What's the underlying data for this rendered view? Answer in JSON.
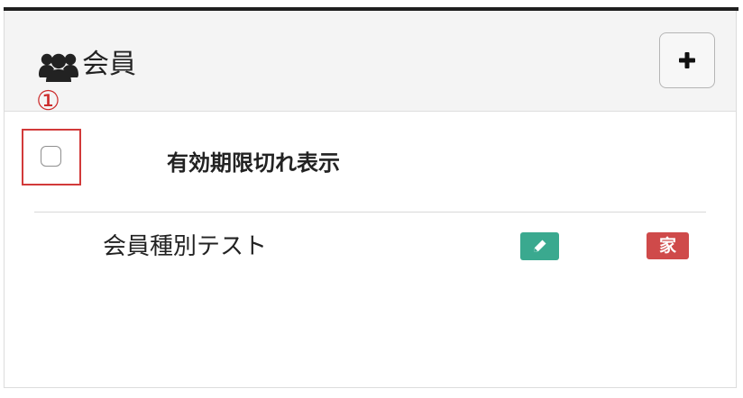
{
  "panel": {
    "title": "会員",
    "title_icon": "users-icon",
    "add_button_icon": "plus-icon",
    "add_button_label": "+"
  },
  "annotation": {
    "marker": "①",
    "color": "#d23a3a"
  },
  "filter": {
    "checkbox_checked": false,
    "label": "有効期限切れ表示"
  },
  "members": [
    {
      "name": "会員種別テスト",
      "edit_icon": "pencil-icon",
      "badge": "家",
      "edit_color": "#3aa98f",
      "badge_color": "#cf4a4a"
    }
  ],
  "colors": {
    "header_bg": "#f4f4f4",
    "top_border": "#1f1f1f",
    "edit_green": "#3aa98f",
    "badge_red": "#cf4a4a",
    "annotation_red": "#d23a3a"
  }
}
